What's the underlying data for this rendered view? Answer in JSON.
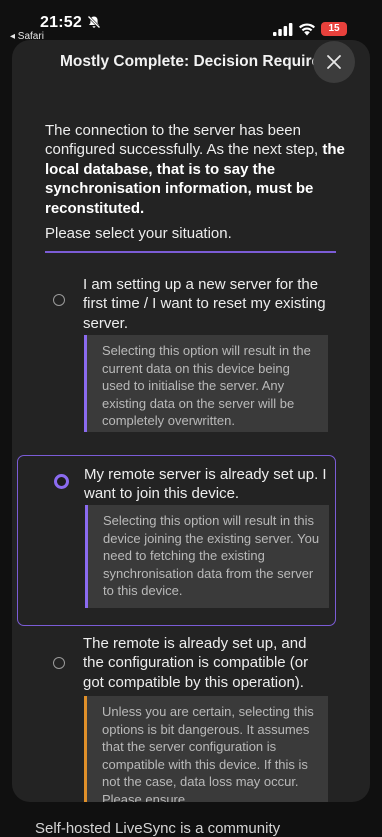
{
  "status_bar": {
    "time": "21:52",
    "back_app": "◂ Safari",
    "battery": "15",
    "icons": [
      "bell-slash-icon",
      "signal-icon",
      "wifi-icon",
      "battery-icon"
    ]
  },
  "dialog": {
    "title": "Mostly Complete: Decision Required",
    "intro_plain": "The connection to the server has been configured successfully. As the next step, ",
    "intro_bold": "the local database, that is to say the synchronisation information, must be reconstituted.",
    "prompt": "Please select your situation.",
    "options": [
      {
        "label": "I am setting up a new server for the first time / I want to reset my existing server.",
        "note": "Selecting this option will result in the current data on this device being used to initialise the server. Any existing data on the server will be completely overwritten.",
        "selected": false
      },
      {
        "label": "My remote server is already set up. I want to join this device.",
        "note": "Selecting this option will result in this device joining the existing server. You need to fetching the existing synchronisation data from the server to this device.",
        "selected": true
      },
      {
        "label": "The remote is already set up, and the configuration is compatible (or got compatible by this operation).",
        "note": "Unless you are certain, selecting this options is bit dangerous. It assumes that the server configuration is compatible with this device. If this is not the case, data loss may occur. Please ensure",
        "selected": false
      }
    ]
  },
  "background_page": {
    "text": "Self-hosted LiveSync is a community"
  },
  "colors": {
    "accent": "#8b6bf0",
    "warning": "#e0902a",
    "sheet_bg": "#232323",
    "page_bg": "#101010"
  }
}
